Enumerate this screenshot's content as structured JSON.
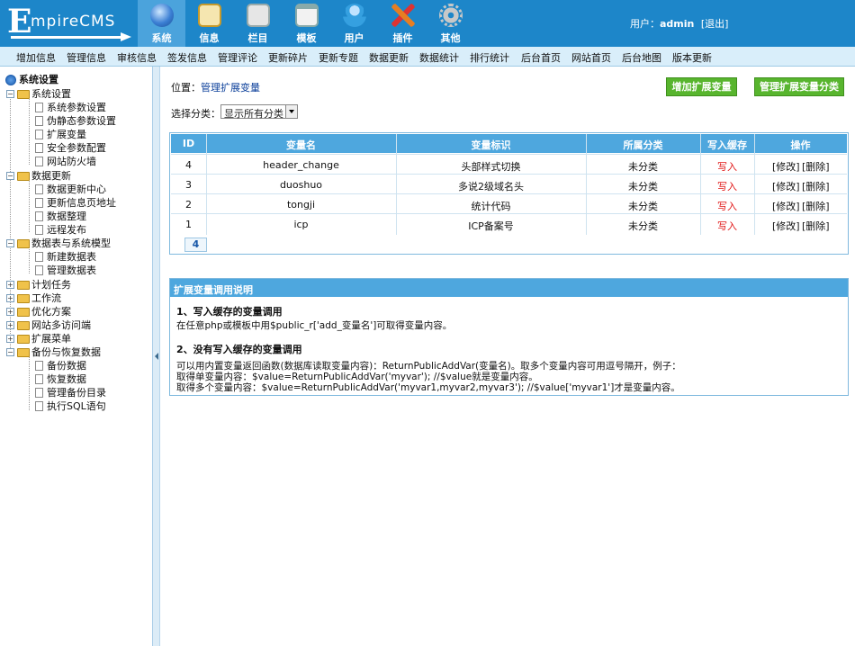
{
  "logo": {
    "big": "E",
    "rest": "mpireCMS"
  },
  "nav_tabs": [
    {
      "label": "系统",
      "icon": "globe-icon",
      "color": "#3b7fd4"
    },
    {
      "label": "信息",
      "icon": "notepad-icon",
      "color": "#e9c46a"
    },
    {
      "label": "栏目",
      "icon": "folder-icon",
      "color": "#d9d9d9"
    },
    {
      "label": "模板",
      "icon": "window-icon",
      "color": "#e0e0e0"
    },
    {
      "label": "用户",
      "icon": "user-icon",
      "color": "#35a0e0"
    },
    {
      "label": "插件",
      "icon": "tools-icon",
      "color": "#e67e22"
    },
    {
      "label": "其他",
      "icon": "gear-icon",
      "color": "#a0a0a0"
    }
  ],
  "user": {
    "prefix": "用户：",
    "name": "admin",
    "logout": "[退出]"
  },
  "menu": [
    "增加信息",
    "管理信息",
    "审核信息",
    "签发信息",
    "管理评论",
    "更新碎片",
    "更新专题",
    "数据更新",
    "数据统计",
    "排行统计",
    "后台首页",
    "网站首页",
    "后台地图",
    "版本更新"
  ],
  "tree": {
    "root": "系统设置",
    "groups": [
      {
        "label": "系统设置",
        "children": [
          "系统参数设置",
          "伪静态参数设置",
          "扩展变量",
          "安全参数配置",
          "网站防火墙"
        ]
      },
      {
        "label": "数据更新",
        "children": [
          "数据更新中心",
          "更新信息页地址",
          "数据整理",
          "远程发布"
        ]
      },
      {
        "label": "数据表与系统模型",
        "children": [
          "新建数据表",
          "管理数据表"
        ]
      },
      {
        "label": "计划任务",
        "children": []
      },
      {
        "label": "工作流",
        "children": []
      },
      {
        "label": "优化方案",
        "children": []
      },
      {
        "label": "网站多访问端",
        "children": []
      },
      {
        "label": "扩展菜单",
        "children": []
      },
      {
        "label": "备份与恢复数据",
        "children": [
          "备份数据",
          "恢复数据",
          "管理备份目录",
          "执行SQL语句"
        ]
      }
    ]
  },
  "crumb": {
    "prefix": "位置：",
    "link": "管理扩展变量"
  },
  "buttons": {
    "add": "增加扩展变量",
    "manage": "管理扩展变量分类"
  },
  "filter": {
    "label": "选择分类：",
    "selected": "显示所有分类"
  },
  "table": {
    "headers": [
      "ID",
      "变量名",
      "变量标识",
      "所属分类",
      "写入缓存",
      "操作"
    ],
    "rows": [
      {
        "id": "4",
        "name": "header_change",
        "tag": "头部样式切换",
        "cat": "未分类",
        "cache": "写入",
        "edit": "[修改]",
        "del": "[删除]"
      },
      {
        "id": "3",
        "name": "duoshuo",
        "tag": "多说2级域名头",
        "cat": "未分类",
        "cache": "写入",
        "edit": "[修改]",
        "del": "[删除]"
      },
      {
        "id": "2",
        "name": "tongji",
        "tag": "统计代码",
        "cat": "未分类",
        "cache": "写入",
        "edit": "[修改]",
        "del": "[删除]"
      },
      {
        "id": "1",
        "name": "icp",
        "tag": "ICP备案号",
        "cat": "未分类",
        "cache": "写入",
        "edit": "[修改]",
        "del": "[删除]"
      }
    ],
    "page": "4"
  },
  "note": {
    "title": "扩展变量调用说明",
    "h1": "1、写入缓存的变量调用",
    "p1": "在任意php或模板中用$public_r['add_变量名']可取得变量内容。",
    "h2": "2、没有写入缓存的变量调用",
    "p2": "可以用内置变量返回函数(数据库读取变量内容)：ReturnPublicAddVar(变量名)。取多个变量内容可用逗号隔开，例子：",
    "p3": "取得单变量内容：$value=ReturnPublicAddVar('myvar'); //$value就是变量内容。",
    "p4": "取得多个变量内容：$value=ReturnPublicAddVar('myvar1,myvar2,myvar3'); //$value['myvar1']才是变量内容。"
  }
}
